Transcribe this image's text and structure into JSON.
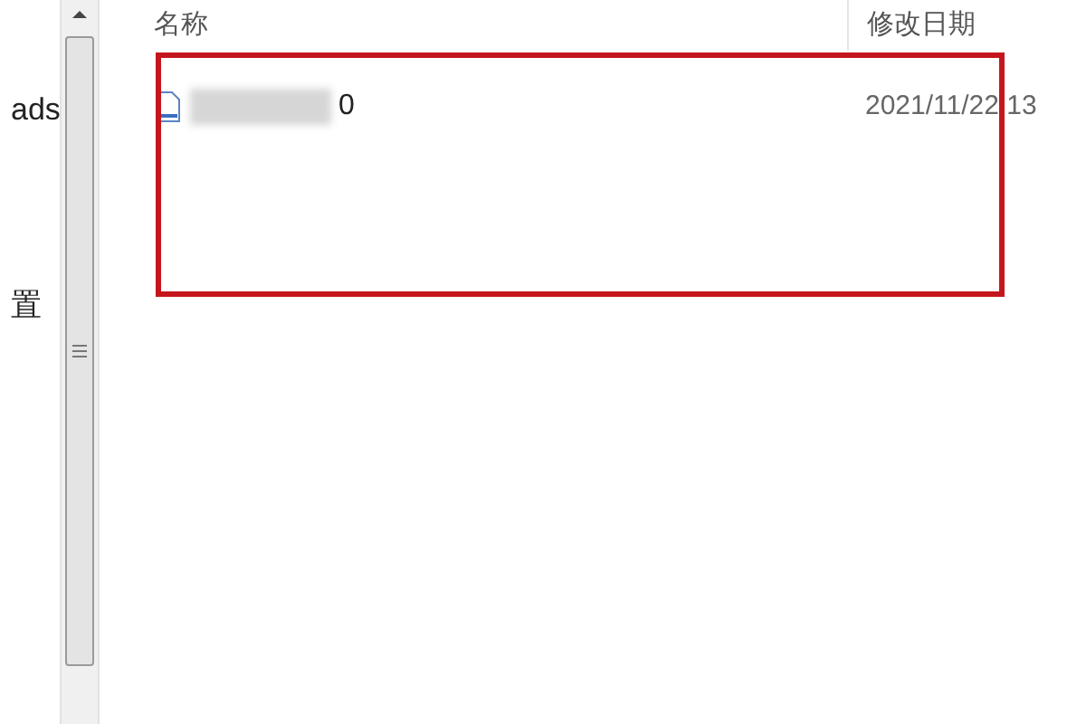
{
  "sidebar": {
    "items": [
      {
        "label": "ads"
      },
      {
        "label": "置"
      }
    ]
  },
  "table": {
    "columns": [
      "名称",
      "修改日期"
    ],
    "rows": [
      {
        "name": "0",
        "modified": "2021/11/22 13"
      }
    ]
  }
}
